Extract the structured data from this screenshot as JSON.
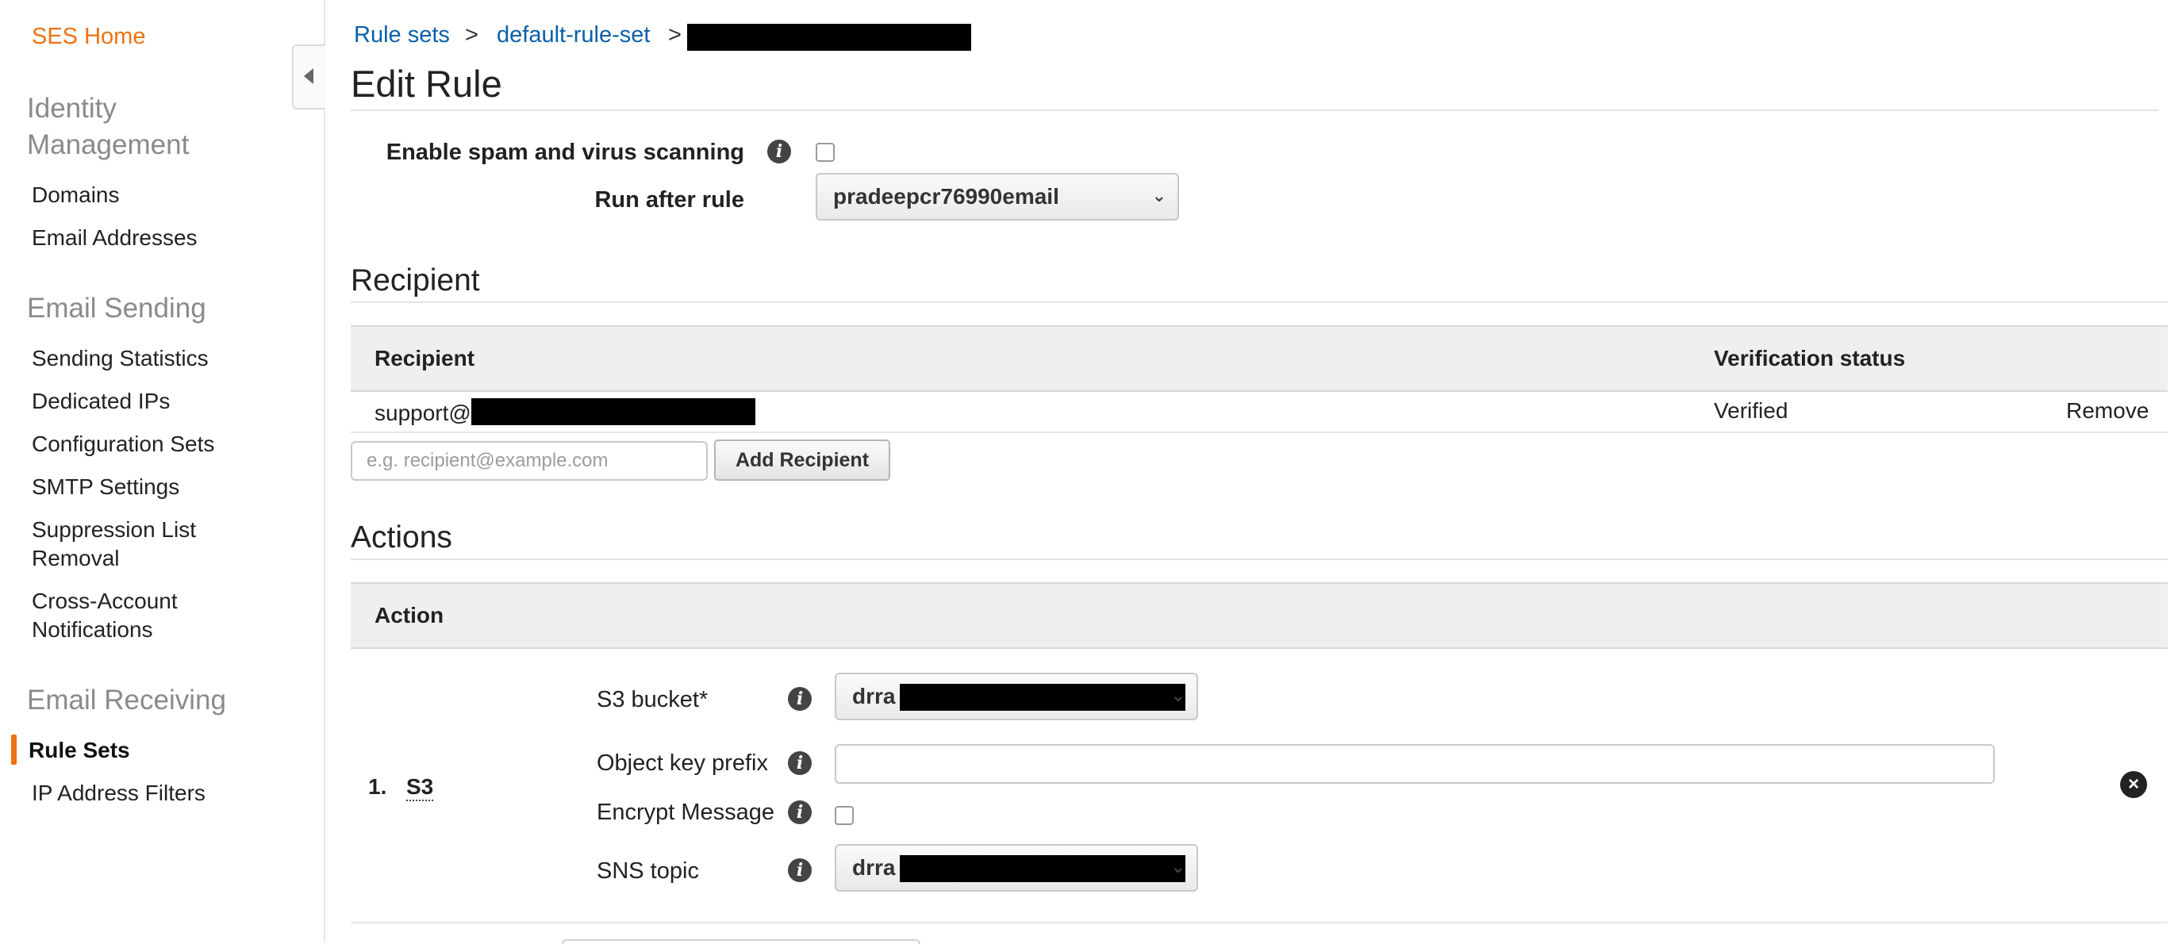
{
  "sidebar": {
    "home": "SES Home",
    "sections": [
      {
        "heading": "Identity Management",
        "heading_line1": "Identity",
        "heading_line2": "Management",
        "items": [
          "Domains",
          "Email Addresses"
        ]
      },
      {
        "heading": "Email Sending",
        "items": [
          "Sending Statistics",
          "Dedicated IPs",
          "Configuration Sets",
          "SMTP Settings",
          "Suppression List Removal",
          "Cross-Account Notifications"
        ]
      },
      {
        "heading": "Email Receiving",
        "items": [
          "Rule Sets",
          "IP Address Filters"
        ],
        "active": "Rule Sets"
      }
    ],
    "suppression_line1": "Suppression List",
    "suppression_line2": "Removal",
    "crossaccount_line1": "Cross-Account",
    "crossaccount_line2": "Notifications"
  },
  "breadcrumb": {
    "root": "Rule sets",
    "separator": ">",
    "rule_set": "default-rule-set"
  },
  "page_title": "Edit Rule",
  "settings": {
    "spam_label": "Enable spam and virus scanning",
    "spam_checked": false,
    "run_after_label": "Run after rule",
    "run_after_value": "pradeepcr76990email"
  },
  "recipient": {
    "section_title": "Recipient",
    "col_recipient": "Recipient",
    "col_status": "Verification status",
    "rows": [
      {
        "email_prefix": "support@",
        "status": "Verified",
        "action": "Remove"
      }
    ],
    "input_placeholder": "e.g. recipient@example.com",
    "add_button": "Add Recipient"
  },
  "actions": {
    "section_title": "Actions",
    "col_action": "Action",
    "items": [
      {
        "number": "1.",
        "type": "S3",
        "s3_bucket_label": "S3 bucket*",
        "s3_bucket_value": "drra",
        "object_prefix_label": "Object key prefix",
        "object_prefix_value": "",
        "encrypt_label": "Encrypt Message",
        "encrypt_checked": false,
        "sns_label": "SNS topic",
        "sns_value": "drra"
      }
    ]
  },
  "colors": {
    "accent_orange": "#ec7211",
    "link_blue": "#0a5fa8"
  }
}
